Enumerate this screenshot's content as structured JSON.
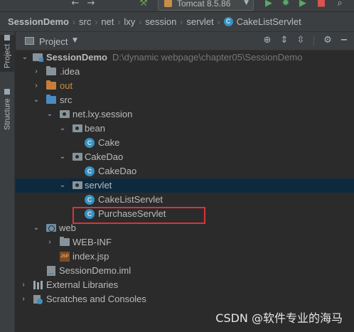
{
  "toolbar": {
    "run_config": "Tomcat 8.5.86",
    "icons": [
      "back-icon",
      "forward-icon",
      "build-hammer-icon",
      "run-icon",
      "debug-icon",
      "coverage-icon",
      "stop-icon",
      "search-icon"
    ]
  },
  "breadcrumb": {
    "items": [
      "SessionDemo",
      "src",
      "net",
      "lxy",
      "session",
      "servlet",
      "CakeListServlet"
    ]
  },
  "tool_strip": {
    "project_tab": "Project",
    "structure_tab": "Structure"
  },
  "panel": {
    "title": "Project"
  },
  "tree": {
    "root": {
      "label": "SessionDemo",
      "path": "D:\\dynamic webpage\\chapter05\\SessionDemo"
    },
    "idea": ".idea",
    "out": "out",
    "src": "src",
    "package": "net.lxy.session",
    "bean": "bean",
    "cake": "Cake",
    "cakedao_pkg": "CakeDao",
    "cakedao_class": "CakeDao",
    "servlet": "servlet",
    "cakelist": "CakeListServlet",
    "purchase": "PurchaseServlet",
    "web": "web",
    "webinf": "WEB-INF",
    "indexjsp": "index.jsp",
    "iml": "SessionDemo.iml",
    "extlibs": "External Libraries",
    "scratches": "Scratches and Consoles"
  },
  "colors": {
    "background": "#2b2b2b",
    "panel": "#3c3f41",
    "selection": "#0d293e",
    "highlight_box": "#d9333a",
    "class_icon": "#3592c4",
    "excluded_folder": "#d08b46"
  },
  "watermark": "CSDN @软件专业的海马"
}
